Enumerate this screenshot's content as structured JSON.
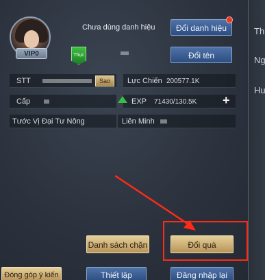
{
  "profile": {
    "vip_label": "VIP0",
    "title_status": "Chưa dùng danh hiệu",
    "faction_badge": "Thục",
    "change_title_button": "Đổi danh hiệu",
    "rename_button": "Đổi tên"
  },
  "stats": {
    "stt_label": "STT",
    "copy_button": "Sao",
    "power_label": "Lực Chiến",
    "power_value": "200577.1K",
    "level_label": "Cấp",
    "exp_label": "EXP",
    "exp_value": "71430/130.5K",
    "rank_label": "Tước Vị",
    "rank_value": "Đại Tư Nông",
    "alliance_label": "Liên Minh"
  },
  "right_panel": {
    "labels": [
      "Th",
      "Ng",
      "Hu"
    ]
  },
  "actions": {
    "blocklist_button": "Danh sách chặn",
    "gift_button": "Đổi quà",
    "feedback_button": "Đóng góp ý kiến",
    "settings_button": "Thiết lập",
    "relogin_button": "Đăng nhập lại"
  },
  "colors": {
    "highlight": "#ff2a18",
    "accent_blue": "#2c4d80",
    "accent_gold": "#b89458"
  }
}
